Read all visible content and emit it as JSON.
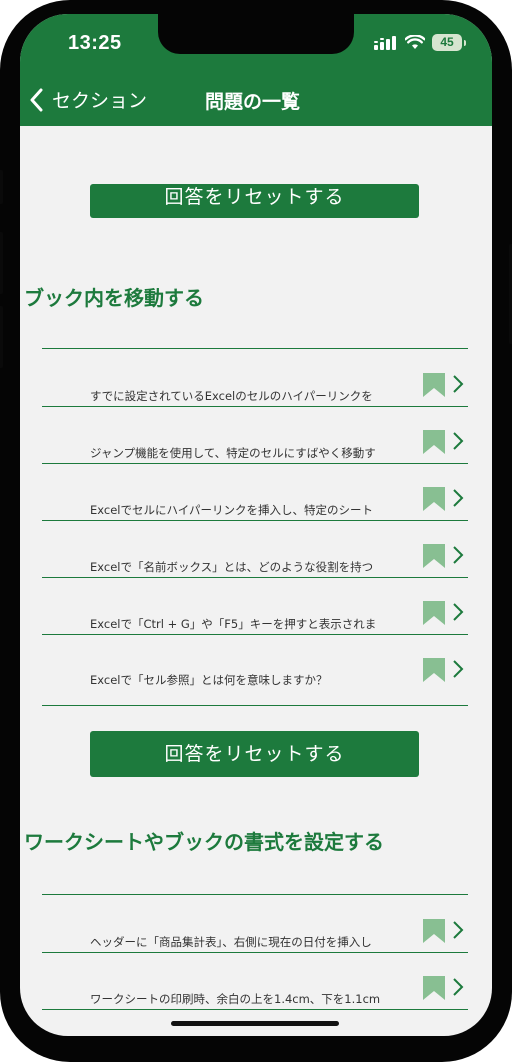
{
  "status_bar": {
    "time": "13:25",
    "battery": "45",
    "signal_icon": "signal-icon",
    "wifi_icon": "wifi-icon"
  },
  "nav": {
    "back_label": "セクション",
    "title": "問題の一覧",
    "back_icon": "chevron-left-icon"
  },
  "colors": {
    "primary": "#1d7a3d",
    "background": "#f2f2f2",
    "bookmark": "#88bf92",
    "text": "#333333"
  },
  "sections": [
    {
      "title": "ブック内を移動する",
      "reset_label": "回答をリセットする",
      "questions": [
        "すでに設定されているExcelのセルのハイパーリンクを",
        "ジャンプ機能を使用して、特定のセルにすばやく移動す",
        "Excelでセルにハイパーリンクを挿入し、特定のシート",
        "Excelで「名前ボックス」とは、どのような役割を持つ",
        "Excelで「Ctrl + G」や「F5」キーを押すと表示されま",
        "Excelで「セル参照」とは何を意味しますか？"
      ]
    },
    {
      "title": "ワークシートやブックの書式を設定する",
      "questions": [
        "ヘッダーに「商品集計表」、右側に現在の日付を挿入し",
        "ワークシートの印刷時、余白の上を1.4cm、下を1.1cm"
      ]
    }
  ],
  "top_reset_label": "回答をリセットする"
}
